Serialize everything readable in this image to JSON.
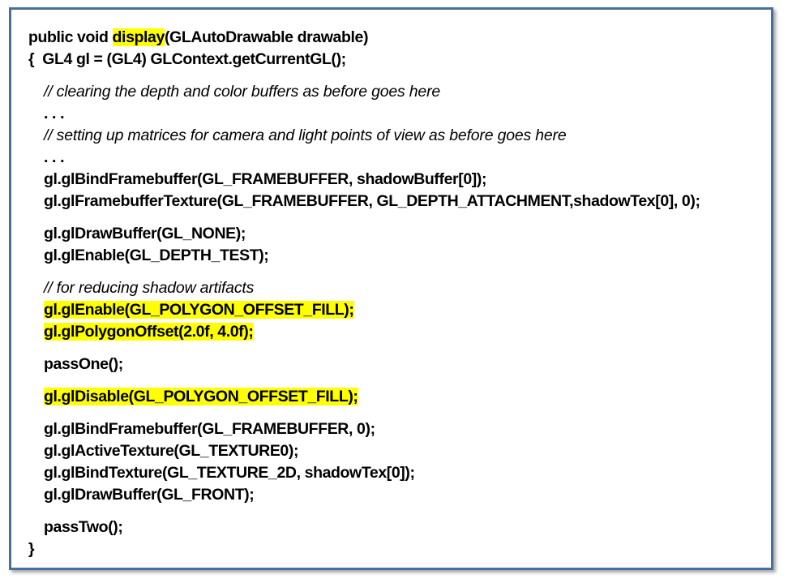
{
  "code": {
    "header_prefix": "public void ",
    "header_highlight": "display",
    "header_suffix": "(GLAutoDrawable drawable)",
    "line_open": "{  GL4 gl = (GL4) GLContext.getCurrentGL();",
    "comment_clear": "// clearing the depth and color buffers as before goes here",
    "ellipsis_1": ". . .",
    "comment_matrices": "// setting up matrices for camera and light points of view as before goes here",
    "ellipsis_2": ". . .",
    "bind_framebuffer": "gl.glBindFramebuffer(GL_FRAMEBUFFER, shadowBuffer[0]);",
    "framebuffer_texture": "gl.glFramebufferTexture(GL_FRAMEBUFFER, GL_DEPTH_ATTACHMENT,shadowTex[0], 0);",
    "draw_buffer_none": "gl.glDrawBuffer(GL_NONE);",
    "enable_depth": "gl.glEnable(GL_DEPTH_TEST);",
    "comment_artifacts": "// for reducing shadow artifacts",
    "enable_offset": "gl.glEnable(GL_POLYGON_OFFSET_FILL);",
    "polygon_offset": "gl.glPolygonOffset(2.0f, 4.0f);",
    "pass_one": "passOne();",
    "disable_offset": "gl.glDisable(GL_POLYGON_OFFSET_FILL);",
    "bind_framebuffer_0": "gl.glBindFramebuffer(GL_FRAMEBUFFER, 0);",
    "active_texture": "gl.glActiveTexture(GL_TEXTURE0);",
    "bind_texture": "gl.glBindTexture(GL_TEXTURE_2D, shadowTex[0]);",
    "draw_buffer_front": "gl.glDrawBuffer(GL_FRONT);",
    "pass_two": "passTwo();",
    "line_close": "}"
  },
  "colors": {
    "border": "#4a6e9a",
    "highlight": "#ffff00",
    "text": "#000000"
  }
}
